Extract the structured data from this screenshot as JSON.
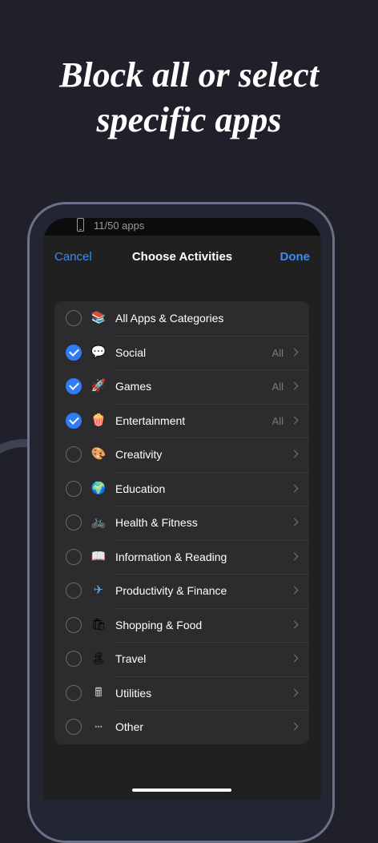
{
  "headline": {
    "line1": "Block all or select",
    "line2": "specific apps"
  },
  "status_bar": {
    "app_count": "11/50 apps",
    "icon": "phone-icon"
  },
  "nav": {
    "cancel": "Cancel",
    "title": "Choose Activities",
    "done": "Done"
  },
  "colors": {
    "accent": "#3b8cf0",
    "checked": "#2f7cf6",
    "background": "#1f2029",
    "list_bg": "#2c2c2e"
  },
  "activities": [
    {
      "label": "All Apps & Categories",
      "checked": false,
      "detail": "",
      "chevron": false,
      "icon": "stack-icon",
      "glyph": "📚"
    },
    {
      "label": "Social",
      "checked": true,
      "detail": "All",
      "chevron": true,
      "icon": "speech-heart-icon",
      "glyph": "💬"
    },
    {
      "label": "Games",
      "checked": true,
      "detail": "All",
      "chevron": true,
      "icon": "rocket-icon",
      "glyph": "🚀"
    },
    {
      "label": "Entertainment",
      "checked": true,
      "detail": "All",
      "chevron": true,
      "icon": "popcorn-icon",
      "glyph": "🍿"
    },
    {
      "label": "Creativity",
      "checked": false,
      "detail": "",
      "chevron": true,
      "icon": "palette-icon",
      "glyph": "🎨"
    },
    {
      "label": "Education",
      "checked": false,
      "detail": "",
      "chevron": true,
      "icon": "globe-icon",
      "glyph": "🌍"
    },
    {
      "label": "Health & Fitness",
      "checked": false,
      "detail": "",
      "chevron": true,
      "icon": "bicycle-icon",
      "glyph": "🚲"
    },
    {
      "label": "Information & Reading",
      "checked": false,
      "detail": "",
      "chevron": true,
      "icon": "book-icon",
      "glyph": "📖"
    },
    {
      "label": "Productivity & Finance",
      "checked": false,
      "detail": "",
      "chevron": true,
      "icon": "paper-plane-icon",
      "glyph": "✈"
    },
    {
      "label": "Shopping & Food",
      "checked": false,
      "detail": "",
      "chevron": true,
      "icon": "shopping-bag-icon",
      "glyph": "🛍"
    },
    {
      "label": "Travel",
      "checked": false,
      "detail": "",
      "chevron": true,
      "icon": "island-icon",
      "glyph": "🏝"
    },
    {
      "label": "Utilities",
      "checked": false,
      "detail": "",
      "chevron": true,
      "icon": "calculator-icon",
      "glyph": "🖩"
    },
    {
      "label": "Other",
      "checked": false,
      "detail": "",
      "chevron": true,
      "icon": "ellipsis-icon",
      "glyph": "•••"
    }
  ]
}
